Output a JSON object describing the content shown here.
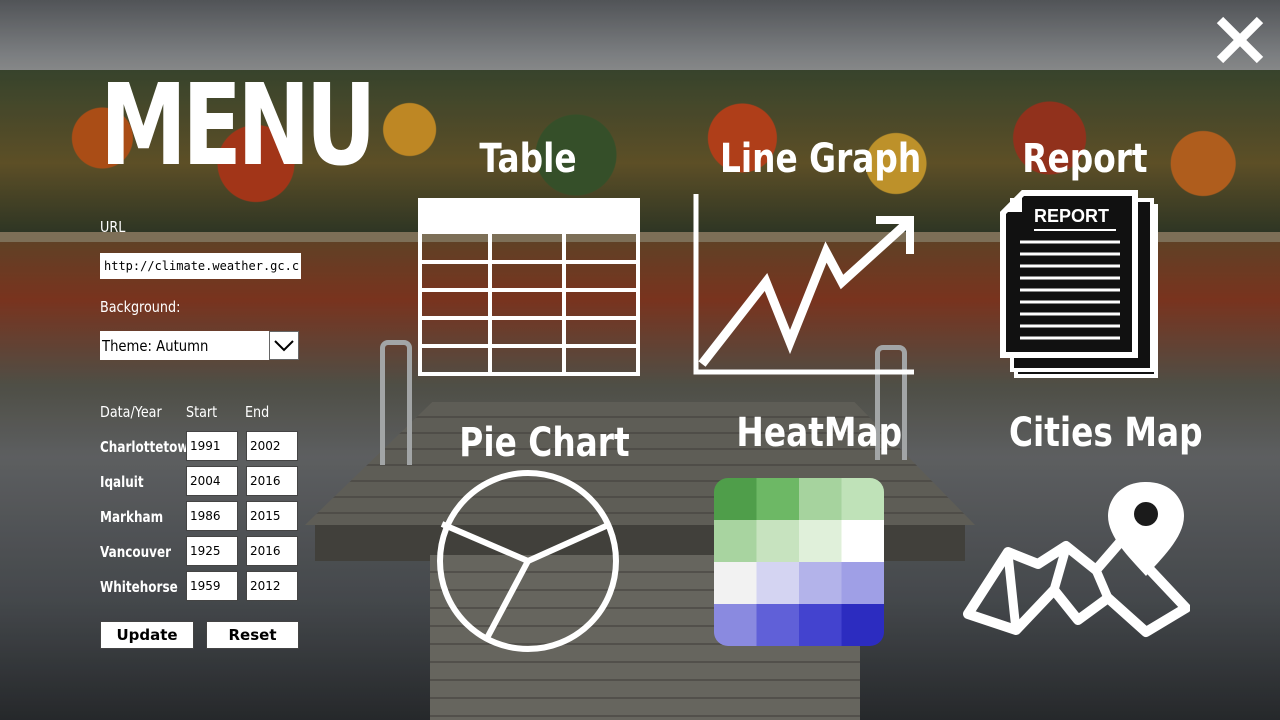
{
  "menu": {
    "title": "MENU",
    "url_label": "URL",
    "url_value": "http://climate.weather.gc.ca/climate_",
    "background_label": "Background:",
    "background_value": "Theme: Autumn",
    "columns": {
      "data": "Data/Year",
      "start": "Start",
      "end": "End"
    },
    "rows": [
      {
        "city": "Charlottetown",
        "start": "1991",
        "end": "2002"
      },
      {
        "city": "Iqaluit",
        "start": "2004",
        "end": "2016"
      },
      {
        "city": "Markham",
        "start": "1986",
        "end": "2015"
      },
      {
        "city": "Vancouver",
        "start": "1925",
        "end": "2016"
      },
      {
        "city": "Whitehorse",
        "start": "1959",
        "end": "2012"
      }
    ],
    "update_label": "Update",
    "reset_label": "Reset"
  },
  "tiles": {
    "table": "Table",
    "line_graph": "Line Graph",
    "report": "Report",
    "report_badge": "REPORT",
    "pie_chart": "Pie Chart",
    "heatmap": "HeatMap",
    "cities_map": "Cities Map"
  },
  "icons": {
    "close": "close-icon",
    "dropdown": "chevron-down-icon",
    "table": "table-icon",
    "line_graph": "line-graph-icon",
    "report": "report-icon",
    "pie_chart": "pie-chart-icon",
    "heatmap": "heatmap-icon",
    "cities_map": "map-pin-icon"
  },
  "heatmap_colors": [
    [
      "#4f9e4a",
      "#6db865",
      "#a6d39e",
      "#bfe2b8"
    ],
    [
      "#a8d4a0",
      "#c7e3bf",
      "#e0f0da",
      "#ffffff"
    ],
    [
      "#f2f2f2",
      "#d4d4f2",
      "#b3b3ea",
      "#9f9fe6"
    ],
    [
      "#8a8ae0",
      "#6060d8",
      "#4343cf",
      "#2c2cc0"
    ]
  ]
}
